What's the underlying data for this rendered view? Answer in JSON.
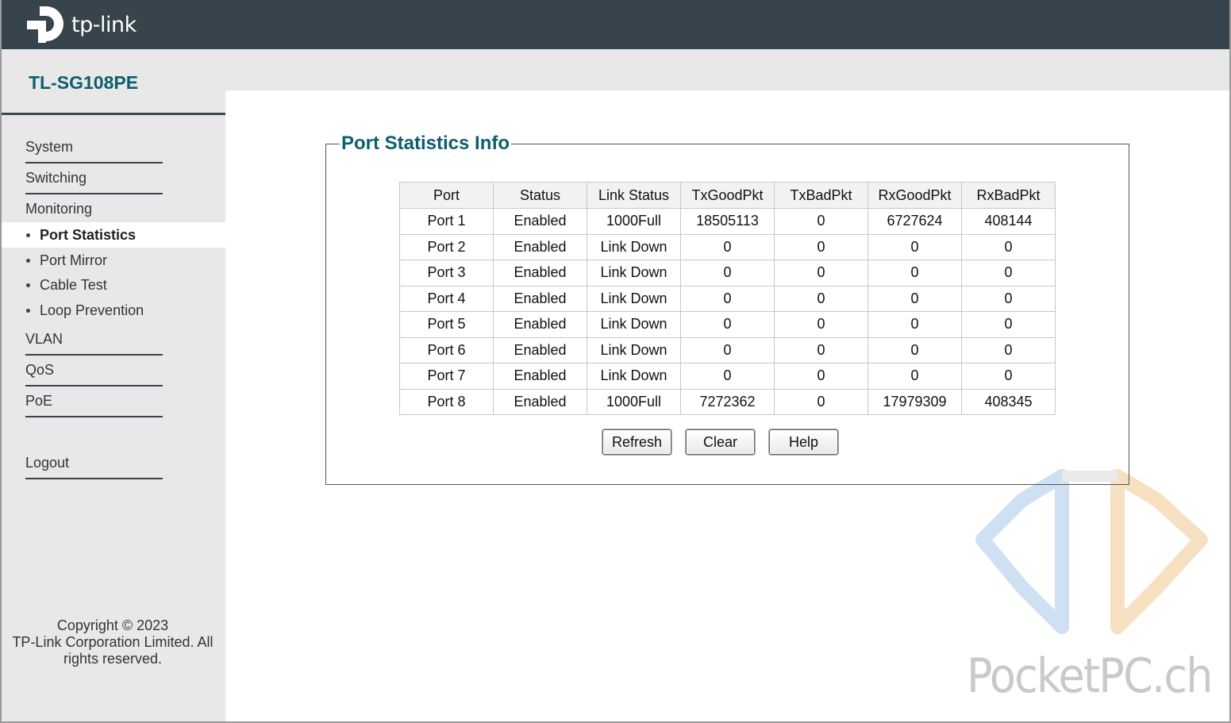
{
  "header": {
    "brand": "tp-link"
  },
  "sidebar": {
    "model": "TL-SG108PE",
    "items": [
      {
        "label": "System"
      },
      {
        "label": "Switching"
      },
      {
        "label": "Monitoring"
      },
      {
        "label": "VLAN"
      },
      {
        "label": "QoS"
      },
      {
        "label": "PoE"
      }
    ],
    "sub_items": [
      {
        "label": "Port Statistics",
        "active": true
      },
      {
        "label": "Port Mirror"
      },
      {
        "label": "Cable Test"
      },
      {
        "label": "Loop Prevention"
      }
    ],
    "logout": "Logout",
    "copyright": [
      "Copyright © 2023",
      "TP-Link Corporation Limited. All",
      "rights reserved."
    ]
  },
  "main": {
    "title": "Port Statistics Info",
    "columns": [
      "Port",
      "Status",
      "Link Status",
      "TxGoodPkt",
      "TxBadPkt",
      "RxGoodPkt",
      "RxBadPkt"
    ],
    "rows": [
      [
        "Port 1",
        "Enabled",
        "1000Full",
        "18505113",
        "0",
        "6727624",
        "408144"
      ],
      [
        "Port 2",
        "Enabled",
        "Link Down",
        "0",
        "0",
        "0",
        "0"
      ],
      [
        "Port 3",
        "Enabled",
        "Link Down",
        "0",
        "0",
        "0",
        "0"
      ],
      [
        "Port 4",
        "Enabled",
        "Link Down",
        "0",
        "0",
        "0",
        "0"
      ],
      [
        "Port 5",
        "Enabled",
        "Link Down",
        "0",
        "0",
        "0",
        "0"
      ],
      [
        "Port 6",
        "Enabled",
        "Link Down",
        "0",
        "0",
        "0",
        "0"
      ],
      [
        "Port 7",
        "Enabled",
        "Link Down",
        "0",
        "0",
        "0",
        "0"
      ],
      [
        "Port 8",
        "Enabled",
        "1000Full",
        "7272362",
        "0",
        "17979309",
        "408345"
      ]
    ],
    "buttons": {
      "refresh": "Refresh",
      "clear": "Clear",
      "help": "Help"
    }
  },
  "watermark": {
    "text": "PocketPC.ch"
  },
  "colors": {
    "header_bg": "#37444b",
    "accent": "#0e5e6e",
    "sidebar_bg": "#e8e8e8"
  }
}
